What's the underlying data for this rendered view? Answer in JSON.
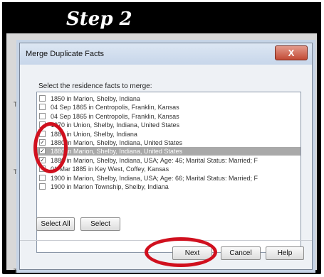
{
  "banner": {
    "title": "Step 2"
  },
  "dialog": {
    "title": "Merge Duplicate Facts",
    "close_label": "X",
    "prompt": "Select the residence facts to merge:",
    "facts": [
      {
        "label": "1850 in Marion, Shelby, Indiana",
        "checked": false,
        "selected": false
      },
      {
        "label": "04 Sep 1865 in Centropolis, Franklin, Kansas",
        "checked": false,
        "selected": false
      },
      {
        "label": "04 Sep 1865 in Centropolis, Franklin, Kansas",
        "checked": false,
        "selected": false
      },
      {
        "label": "1870 in Union, Shelby, Indiana, United States",
        "checked": false,
        "selected": false
      },
      {
        "label": "1880 in Union, Shelby, Indiana",
        "checked": false,
        "selected": false
      },
      {
        "label": "1880 in Marion, Shelby, Indiana, United States",
        "checked": true,
        "selected": false
      },
      {
        "label": "1880 in Marion, Shelby, Indiana, United States",
        "checked": true,
        "selected": true
      },
      {
        "label": "1880 in Marion, Shelby, Indiana, USA; Age: 46; Marital Status: Married; F",
        "checked": true,
        "selected": false
      },
      {
        "label": "01 Mar 1885 in Key West, Coffey, Kansas",
        "checked": false,
        "selected": false
      },
      {
        "label": "1900 in Marion, Shelby, Indiana, USA; Age: 66; Marital Status: Married; F",
        "checked": false,
        "selected": false
      },
      {
        "label": "1900 in Marion Township, Shelby, Indiana",
        "checked": false,
        "selected": false
      }
    ],
    "select_all_label": "Select All",
    "select_label": "Select",
    "next_label": "Next",
    "cancel_label": "Cancel",
    "help_label": "Help"
  },
  "background": {
    "tick_labels": [
      "Tit",
      "Titl",
      "Tit"
    ]
  },
  "colors": {
    "highlight": "#d0101e",
    "banner": "#000000",
    "selected_row": "#a9a9a9"
  }
}
